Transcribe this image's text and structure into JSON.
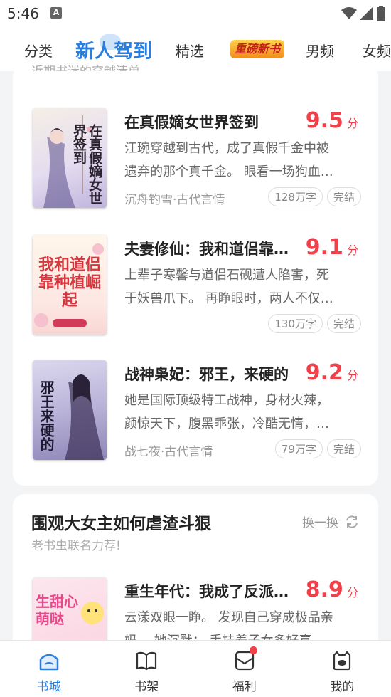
{
  "status_bar": {
    "time": "5:46",
    "badge": "A"
  },
  "top_tabs": [
    {
      "label": "分类",
      "active": false
    },
    {
      "label": "新人驾到",
      "active": true
    },
    {
      "label": "精选",
      "active": false
    },
    {
      "label": "重磅新书",
      "active": false,
      "style": "logo"
    },
    {
      "label": "男频",
      "active": false
    },
    {
      "label": "女频",
      "active": false
    }
  ],
  "card1": {
    "clipped_subtitle": "近期书迷的穿越清单",
    "books": [
      {
        "title": "在真假嫡女世界签到",
        "rating": "9.5",
        "rating_unit": "分",
        "desc_line1": "江琬穿越到古代，成了真假千金中被",
        "desc_line2": "遗弃的那个真千金。 眼看一场狗血…",
        "meta": "沉舟钓雪·古代言情",
        "words": "128万字",
        "status": "完结",
        "cover_text": "在真假嫡女世界签到"
      },
      {
        "title": "夫妻修仙：我和道侣靠…",
        "rating": "9.1",
        "rating_unit": "分",
        "desc_line1": "上辈子寒馨与道侣石砚遭人陷害，死",
        "desc_line2": "于妖兽爪下。 再睁眼时，两人不仅…",
        "meta": "",
        "words": "130万字",
        "status": "完结",
        "cover_text": "我和道侣靠种植崛起"
      },
      {
        "title": "战神枭妃：邪王，来硬的",
        "rating": "9.2",
        "rating_unit": "分",
        "desc_line1": "她是国际顶级特工战神，身材火辣，",
        "desc_line2": "颜惊天下，腹黑乖张，冷酷无情，…",
        "meta": "战七夜·古代言情",
        "words": "79万字",
        "status": "完结",
        "cover_text": "邪王来硬的"
      }
    ]
  },
  "card2": {
    "title": "围观大女主如何虐渣斗狠",
    "subtitle": "老书虫联名力荐!",
    "refresh_label": "换一换",
    "books": [
      {
        "title": "重生年代：我成了反派…",
        "rating": "8.9",
        "rating_unit": "分",
        "desc_line1": "云漾双眼一睁。 发现自己穿成极品亲",
        "desc_line2": "妈。 她沉默： 手挂着子女多好喜",
        "cover_text": "生甜心萌哒"
      }
    ]
  },
  "bottom_nav": [
    {
      "label": "书城",
      "active": true,
      "icon": "home-icon"
    },
    {
      "label": "书架",
      "active": false,
      "icon": "book-icon"
    },
    {
      "label": "福利",
      "active": false,
      "icon": "gift-icon",
      "dot": true
    },
    {
      "label": "我的",
      "active": false,
      "icon": "profile-icon"
    }
  ],
  "colors": {
    "accent": "#2a7ee0",
    "rating": "#f0414b"
  }
}
